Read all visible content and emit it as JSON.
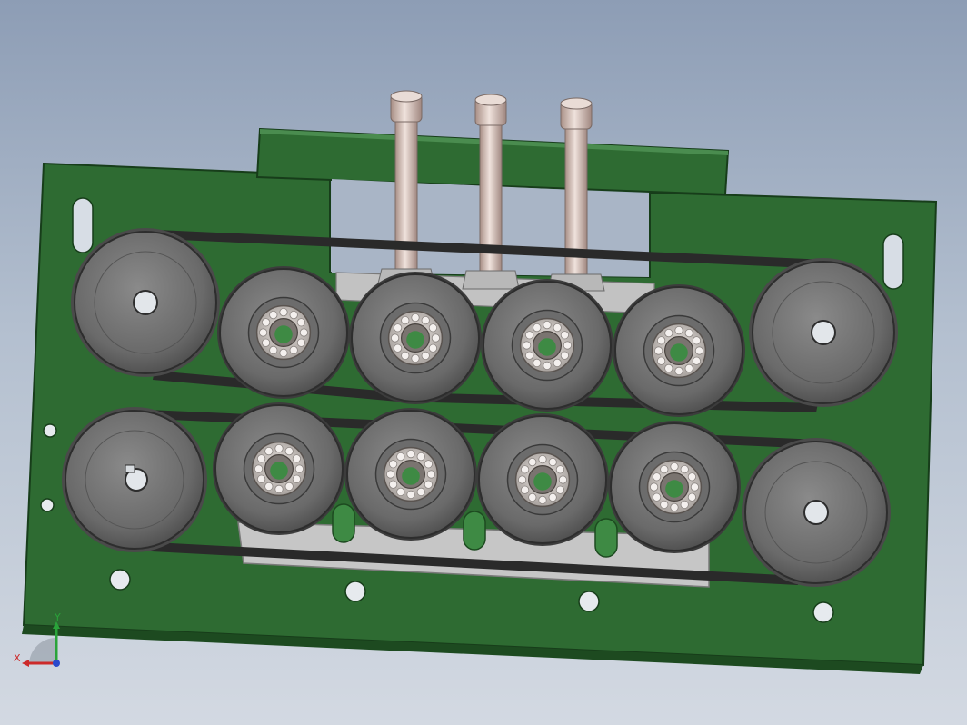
{
  "scene": {
    "description_free": true,
    "colors": {
      "background_top": "#8d9db5",
      "background_bottom": "#d3d9e2",
      "plate": "#2e6b32",
      "plate_edge": "#1d4a20",
      "wheel": "#6e6e6e",
      "wheel_dark": "#3c3c3c",
      "belt": "#2a2a2a",
      "bearing": "#c9c3bf",
      "bolt": "#cdb8b0",
      "bracket": "#c8c8c8"
    },
    "upper_row_bearing_wheels": 4,
    "lower_row_bearing_wheels": 4,
    "bolt_count": 3
  },
  "triad": {
    "x_label": "X",
    "y_label": "Y",
    "x_color": "#cc2a2a",
    "y_color": "#2aa33a",
    "z_color": "#2a4acc"
  }
}
